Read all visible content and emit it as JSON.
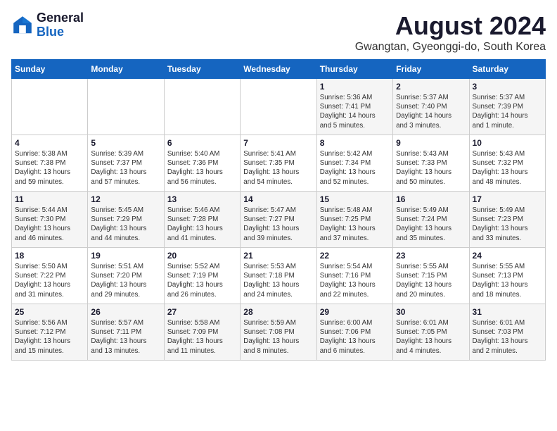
{
  "header": {
    "logo_line1": "General",
    "logo_line2": "Blue",
    "month_year": "August 2024",
    "location": "Gwangtan, Gyeonggi-do, South Korea"
  },
  "days_of_week": [
    "Sunday",
    "Monday",
    "Tuesday",
    "Wednesday",
    "Thursday",
    "Friday",
    "Saturday"
  ],
  "weeks": [
    [
      {
        "day": "",
        "info": ""
      },
      {
        "day": "",
        "info": ""
      },
      {
        "day": "",
        "info": ""
      },
      {
        "day": "",
        "info": ""
      },
      {
        "day": "1",
        "info": "Sunrise: 5:36 AM\nSunset: 7:41 PM\nDaylight: 14 hours\nand 5 minutes."
      },
      {
        "day": "2",
        "info": "Sunrise: 5:37 AM\nSunset: 7:40 PM\nDaylight: 14 hours\nand 3 minutes."
      },
      {
        "day": "3",
        "info": "Sunrise: 5:37 AM\nSunset: 7:39 PM\nDaylight: 14 hours\nand 1 minute."
      }
    ],
    [
      {
        "day": "4",
        "info": "Sunrise: 5:38 AM\nSunset: 7:38 PM\nDaylight: 13 hours\nand 59 minutes."
      },
      {
        "day": "5",
        "info": "Sunrise: 5:39 AM\nSunset: 7:37 PM\nDaylight: 13 hours\nand 57 minutes."
      },
      {
        "day": "6",
        "info": "Sunrise: 5:40 AM\nSunset: 7:36 PM\nDaylight: 13 hours\nand 56 minutes."
      },
      {
        "day": "7",
        "info": "Sunrise: 5:41 AM\nSunset: 7:35 PM\nDaylight: 13 hours\nand 54 minutes."
      },
      {
        "day": "8",
        "info": "Sunrise: 5:42 AM\nSunset: 7:34 PM\nDaylight: 13 hours\nand 52 minutes."
      },
      {
        "day": "9",
        "info": "Sunrise: 5:43 AM\nSunset: 7:33 PM\nDaylight: 13 hours\nand 50 minutes."
      },
      {
        "day": "10",
        "info": "Sunrise: 5:43 AM\nSunset: 7:32 PM\nDaylight: 13 hours\nand 48 minutes."
      }
    ],
    [
      {
        "day": "11",
        "info": "Sunrise: 5:44 AM\nSunset: 7:30 PM\nDaylight: 13 hours\nand 46 minutes."
      },
      {
        "day": "12",
        "info": "Sunrise: 5:45 AM\nSunset: 7:29 PM\nDaylight: 13 hours\nand 44 minutes."
      },
      {
        "day": "13",
        "info": "Sunrise: 5:46 AM\nSunset: 7:28 PM\nDaylight: 13 hours\nand 41 minutes."
      },
      {
        "day": "14",
        "info": "Sunrise: 5:47 AM\nSunset: 7:27 PM\nDaylight: 13 hours\nand 39 minutes."
      },
      {
        "day": "15",
        "info": "Sunrise: 5:48 AM\nSunset: 7:25 PM\nDaylight: 13 hours\nand 37 minutes."
      },
      {
        "day": "16",
        "info": "Sunrise: 5:49 AM\nSunset: 7:24 PM\nDaylight: 13 hours\nand 35 minutes."
      },
      {
        "day": "17",
        "info": "Sunrise: 5:49 AM\nSunset: 7:23 PM\nDaylight: 13 hours\nand 33 minutes."
      }
    ],
    [
      {
        "day": "18",
        "info": "Sunrise: 5:50 AM\nSunset: 7:22 PM\nDaylight: 13 hours\nand 31 minutes."
      },
      {
        "day": "19",
        "info": "Sunrise: 5:51 AM\nSunset: 7:20 PM\nDaylight: 13 hours\nand 29 minutes."
      },
      {
        "day": "20",
        "info": "Sunrise: 5:52 AM\nSunset: 7:19 PM\nDaylight: 13 hours\nand 26 minutes."
      },
      {
        "day": "21",
        "info": "Sunrise: 5:53 AM\nSunset: 7:18 PM\nDaylight: 13 hours\nand 24 minutes."
      },
      {
        "day": "22",
        "info": "Sunrise: 5:54 AM\nSunset: 7:16 PM\nDaylight: 13 hours\nand 22 minutes."
      },
      {
        "day": "23",
        "info": "Sunrise: 5:55 AM\nSunset: 7:15 PM\nDaylight: 13 hours\nand 20 minutes."
      },
      {
        "day": "24",
        "info": "Sunrise: 5:55 AM\nSunset: 7:13 PM\nDaylight: 13 hours\nand 18 minutes."
      }
    ],
    [
      {
        "day": "25",
        "info": "Sunrise: 5:56 AM\nSunset: 7:12 PM\nDaylight: 13 hours\nand 15 minutes."
      },
      {
        "day": "26",
        "info": "Sunrise: 5:57 AM\nSunset: 7:11 PM\nDaylight: 13 hours\nand 13 minutes."
      },
      {
        "day": "27",
        "info": "Sunrise: 5:58 AM\nSunset: 7:09 PM\nDaylight: 13 hours\nand 11 minutes."
      },
      {
        "day": "28",
        "info": "Sunrise: 5:59 AM\nSunset: 7:08 PM\nDaylight: 13 hours\nand 8 minutes."
      },
      {
        "day": "29",
        "info": "Sunrise: 6:00 AM\nSunset: 7:06 PM\nDaylight: 13 hours\nand 6 minutes."
      },
      {
        "day": "30",
        "info": "Sunrise: 6:01 AM\nSunset: 7:05 PM\nDaylight: 13 hours\nand 4 minutes."
      },
      {
        "day": "31",
        "info": "Sunrise: 6:01 AM\nSunset: 7:03 PM\nDaylight: 13 hours\nand 2 minutes."
      }
    ]
  ]
}
